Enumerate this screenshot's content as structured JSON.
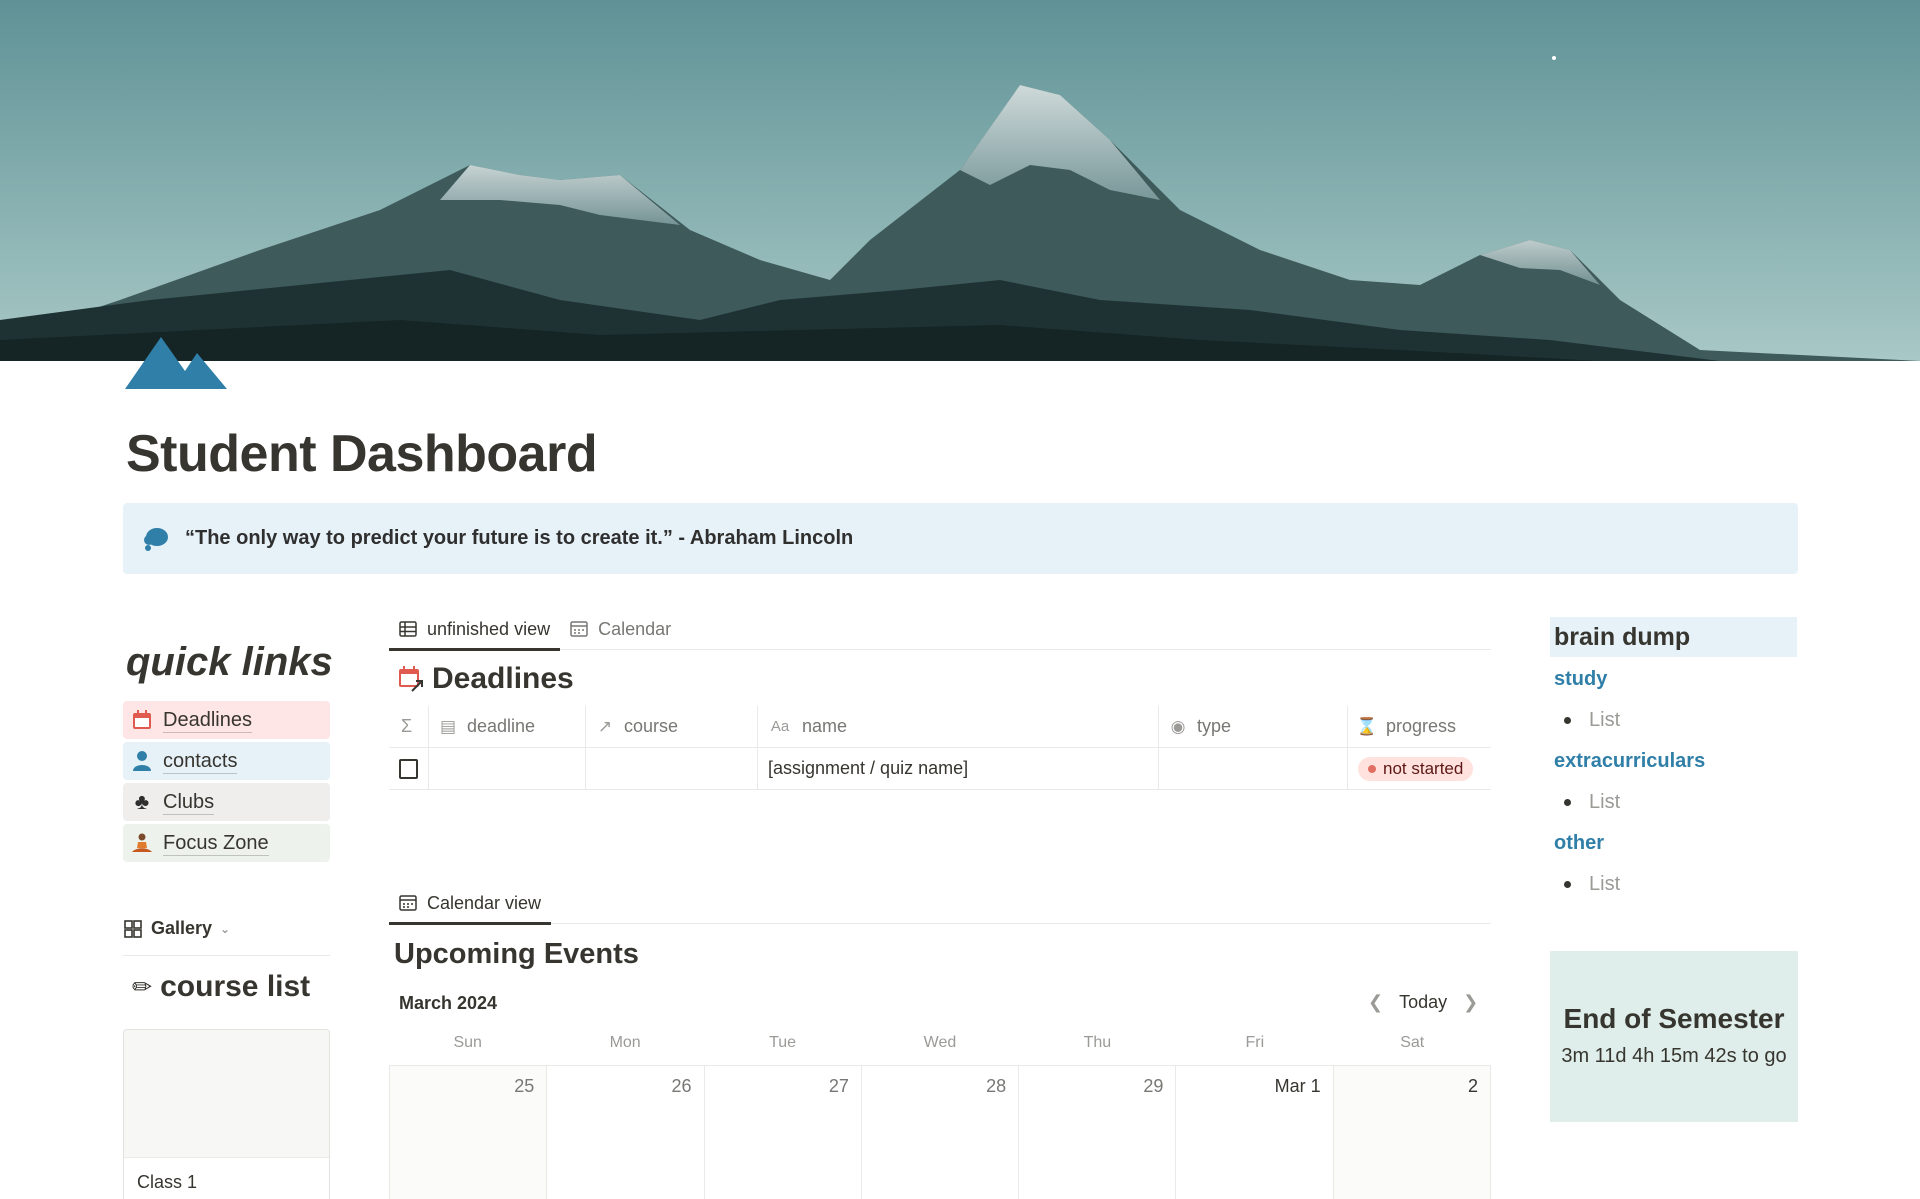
{
  "page": {
    "title": "Student Dashboard",
    "quote": "“The only way to predict your future is to create it.” - Abraham Lincoln"
  },
  "quick_links": {
    "title": "quick links",
    "items": [
      {
        "label": "Deadlines",
        "icon": "calendar-icon",
        "bg": "#fde6e5"
      },
      {
        "label": "contacts",
        "icon": "person-icon",
        "bg": "#e7f2f8"
      },
      {
        "label": "Clubs",
        "icon": "club-suit-icon",
        "bg": "#efeeec"
      },
      {
        "label": "Focus Zone",
        "icon": "meditation-icon",
        "bg": "#edf3ec"
      }
    ]
  },
  "gallery": {
    "tab_label": "Gallery",
    "title": "course list",
    "cards": [
      {
        "name": "Class 1"
      }
    ]
  },
  "deadlines": {
    "tabs": [
      "unfinished view",
      "Calendar"
    ],
    "title": "Deadlines",
    "columns": [
      "deadline",
      "course",
      "name",
      "type",
      "progress"
    ],
    "rows": [
      {
        "deadline": "",
        "course": "",
        "name": "[assignment / quiz name]",
        "type": "",
        "progress": "not started"
      }
    ]
  },
  "events": {
    "tabs": [
      "Calendar view"
    ],
    "title": "Upcoming Events",
    "month": "March 2024",
    "today_label": "Today",
    "weekdays": [
      "Sun",
      "Mon",
      "Tue",
      "Wed",
      "Thu",
      "Fri",
      "Sat"
    ],
    "dates": [
      "25",
      "26",
      "27",
      "28",
      "29",
      "Mar 1",
      "2"
    ]
  },
  "brain_dump": {
    "title": "brain dump",
    "sections": [
      {
        "heading": "study",
        "item": "List"
      },
      {
        "heading": "extracurriculars",
        "item": "List"
      },
      {
        "heading": "other",
        "item": "List"
      }
    ]
  },
  "semester": {
    "title": "End of Semester",
    "countdown": "3m 11d 4h 15m 42s to go"
  },
  "colors": {
    "accent_blue": "#2f7fa8",
    "callout_bg": "#e7f2f8",
    "pill_bg": "#ffe2dd",
    "pill_dot": "#e16f64",
    "semester_bg": "#dfeeea"
  }
}
